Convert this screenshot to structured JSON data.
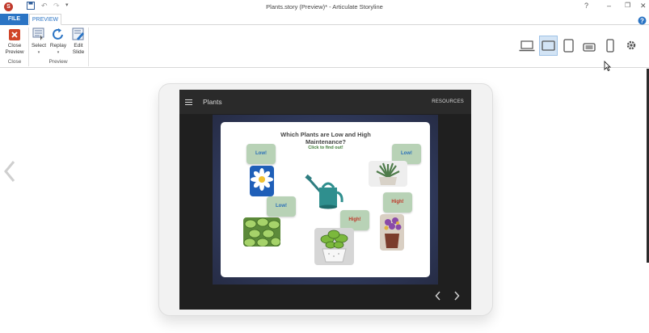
{
  "window": {
    "title": "Plants.story (Preview)* - Articulate Storyline",
    "logo_letter": "S"
  },
  "quick_access": {
    "save_icon": "save-icon",
    "undo_icon": "undo-icon",
    "redo_icon": "redo-icon",
    "customize_icon": "customize-icon"
  },
  "tabs": {
    "file": "FILE",
    "preview": "PREVIEW"
  },
  "ribbon": {
    "close_preview": "Close Preview",
    "select": "Select",
    "replay": "Replay",
    "edit_slide": "Edit Slide",
    "group_close": "Close",
    "group_preview": "Preview"
  },
  "devices": [
    "laptop-icon",
    "tablet-landscape-icon",
    "tablet-portrait-icon",
    "phone-landscape-icon",
    "phone-portrait-icon",
    "gear-icon"
  ],
  "player": {
    "course_title": "Plants",
    "resources": "RESOURCES",
    "prev_icon": "chevron-left-icon",
    "next_icon": "chevron-right-icon"
  },
  "slide": {
    "title": "Which Plants are Low and High Maintenance?",
    "subtitle": "Click to find out!",
    "labels": {
      "low": "Low!",
      "high": "High!"
    }
  },
  "colors": {
    "accent": "#2b74c4",
    "low_text": "#2a6fb8",
    "high_text": "#c0392b",
    "bubble": "#b8d2b6"
  }
}
